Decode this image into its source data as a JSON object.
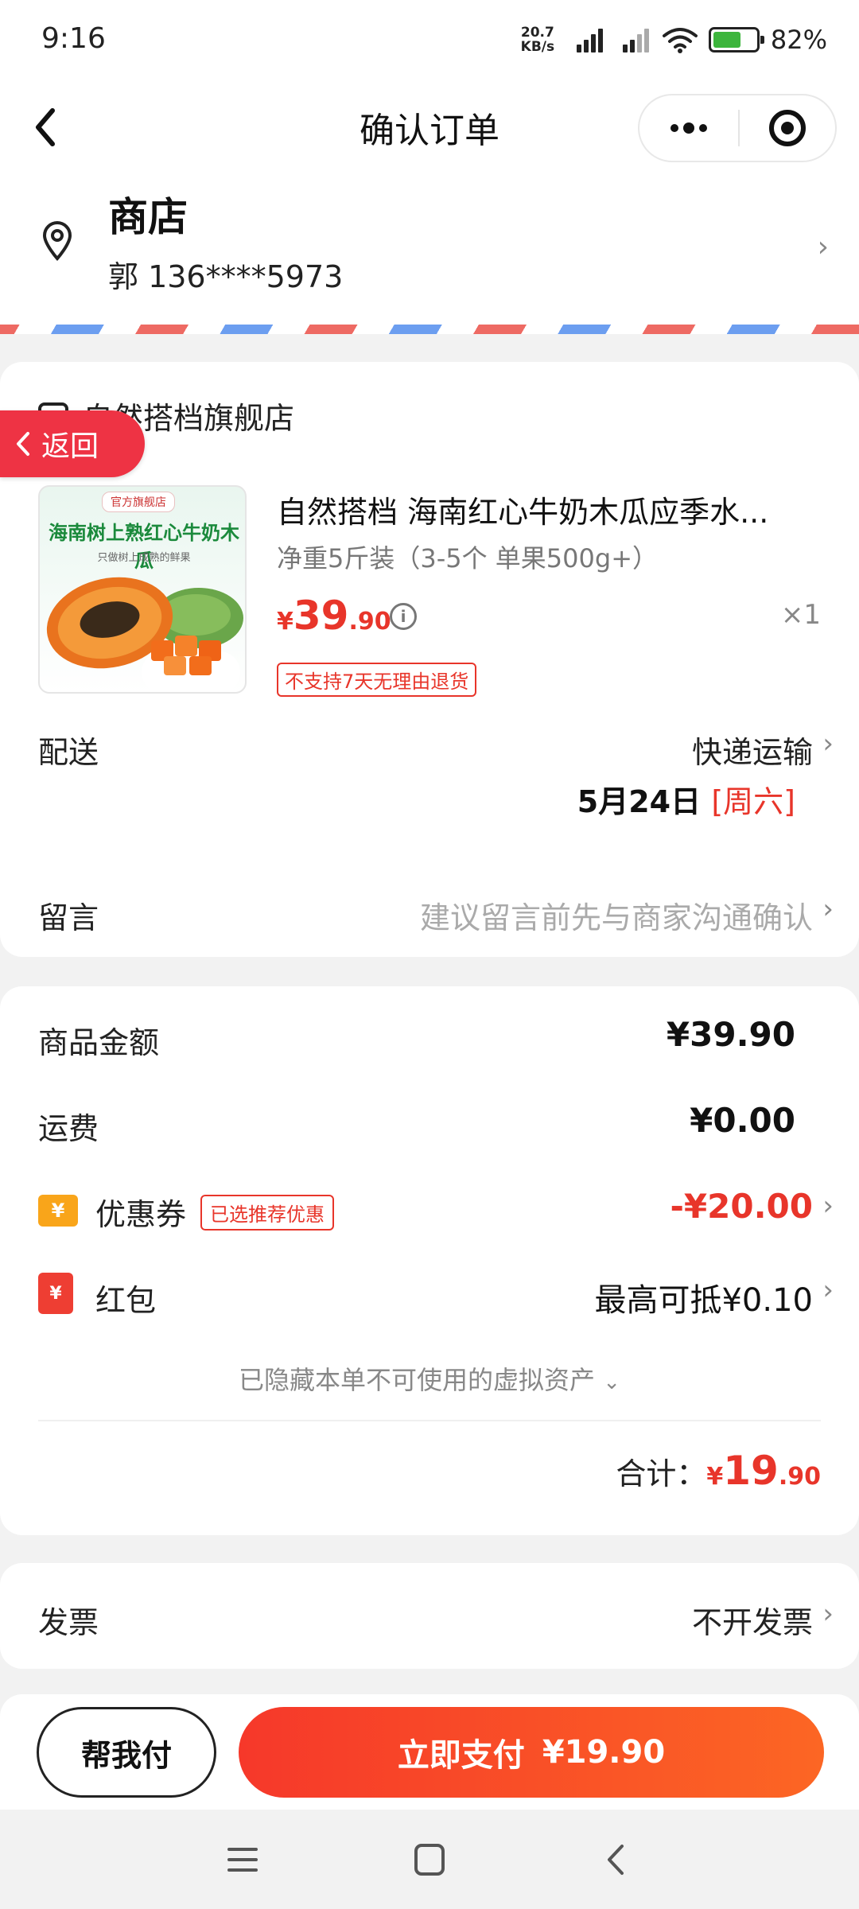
{
  "status": {
    "time": "9:16",
    "net_speed_value": "20.7",
    "net_speed_unit": "KB/s",
    "battery": "82%"
  },
  "nav": {
    "title": "确认订单"
  },
  "address": {
    "name": "商店",
    "contact": "郭 136****5973"
  },
  "order": {
    "shop_name": "自然搭档旗舰店",
    "return_label": "返回",
    "product": {
      "image_badge": "官方旗舰店",
      "image_headline": "海南树上熟红心牛奶木瓜",
      "image_sub": "只做树上成熟的鲜果",
      "title": "自然搭档 海南红心牛奶木瓜应季水...",
      "spec": "净重5斤装（3-5个 单果500g+）",
      "price_currency": "¥",
      "price_int": "39",
      "price_dec": ".90",
      "qty": "×1",
      "no_return": "不支持7天无理由退货"
    },
    "delivery": {
      "label": "配送",
      "method": "快递运输",
      "date": "5月24日",
      "weekday": "[周六]"
    },
    "message": {
      "label": "留言",
      "placeholder": "建议留言前先与商家沟通确认"
    }
  },
  "summary": {
    "goods_label": "商品金额",
    "goods_value": "¥39.90",
    "shipping_label": "运费",
    "shipping_value": "¥0.00",
    "coupon_label": "优惠券",
    "coupon_badge": "已选推荐优惠",
    "coupon_value": "-¥20.00",
    "redpack_label": "红包",
    "redpack_value": "最高可抵¥0.10",
    "hidden_assets": "已隐藏本单不可使用的虚拟资产",
    "total_label": "合计：",
    "total_currency": "¥",
    "total_int": "19",
    "total_dec": ".90"
  },
  "invoice": {
    "label": "发票",
    "value": "不开发票"
  },
  "actions": {
    "help_pay": "帮我付",
    "pay_label": "立即支付",
    "pay_amount": "¥19.90"
  },
  "colors": {
    "accent_red": "#e8352a",
    "coupon_orange": "#f9a51a"
  }
}
